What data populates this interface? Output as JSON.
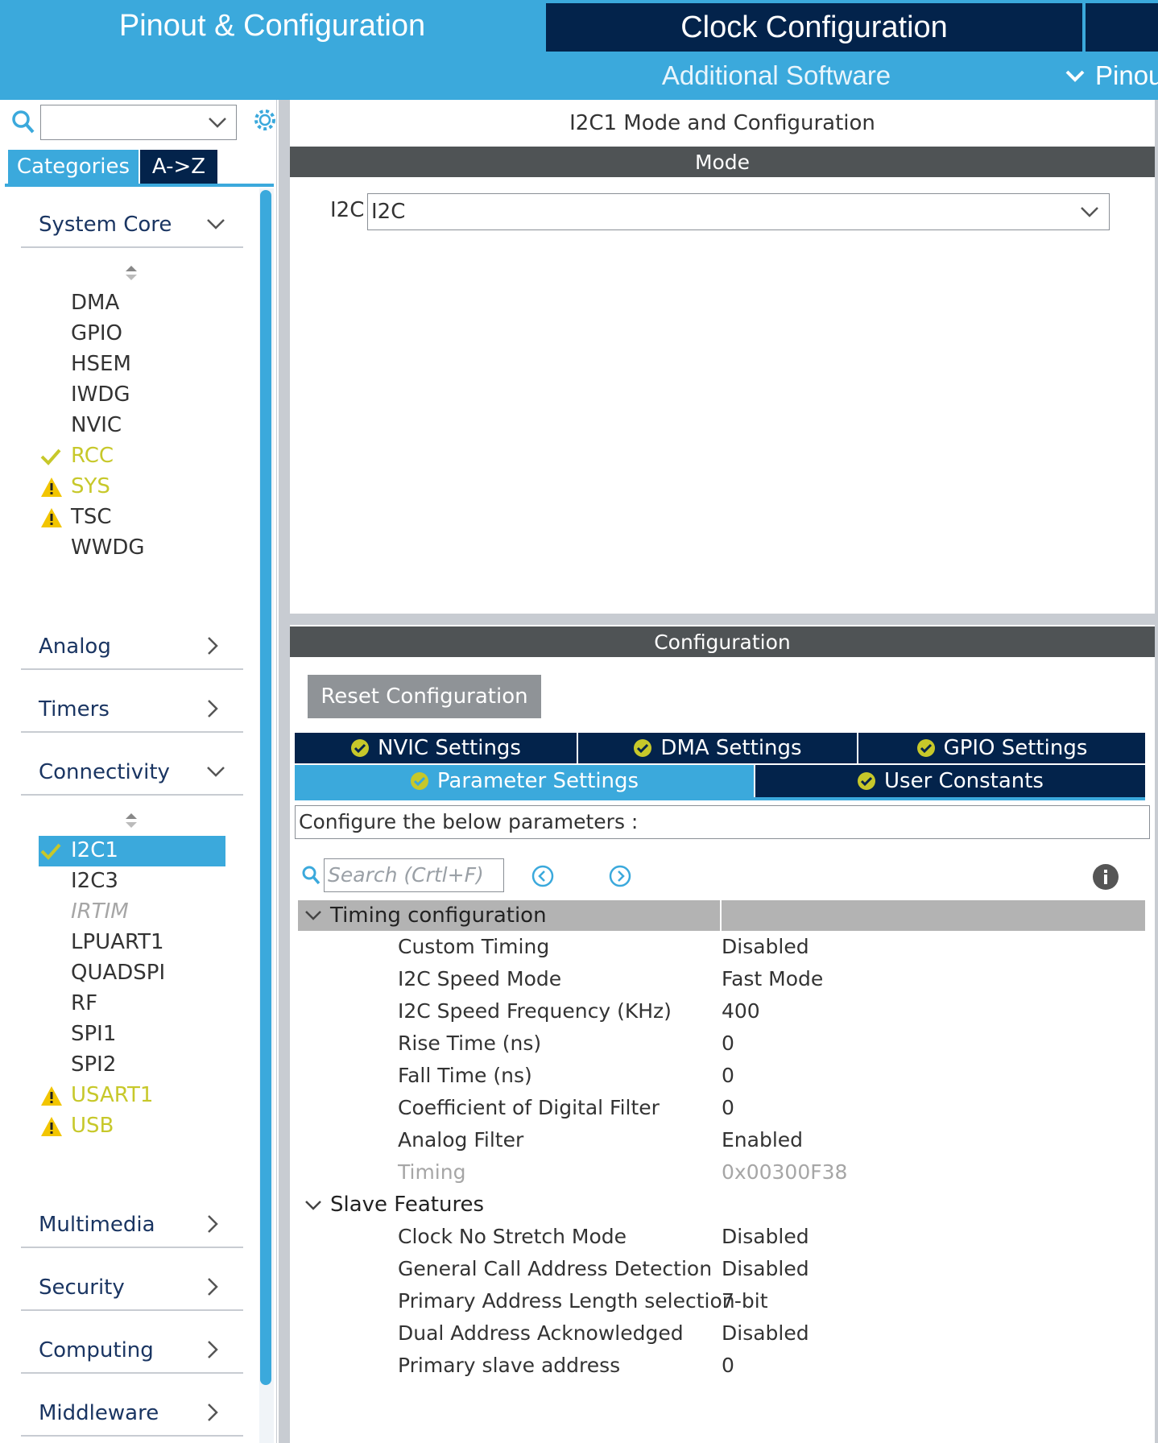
{
  "header": {
    "tabs": [
      {
        "label": "Pinout & Configuration",
        "active": true
      },
      {
        "label": "Clock Configuration",
        "active": false
      }
    ],
    "subnav": {
      "software": "Additional Software",
      "pinout": "Pinout"
    }
  },
  "sidebar": {
    "search_value": "",
    "mode_tabs": [
      "Categories",
      "A->Z"
    ],
    "categories": [
      {
        "label": "System Core",
        "expanded": true
      },
      {
        "label": "Analog",
        "expanded": false
      },
      {
        "label": "Timers",
        "expanded": false
      },
      {
        "label": "Connectivity",
        "expanded": true
      },
      {
        "label": "Multimedia",
        "expanded": false
      },
      {
        "label": "Security",
        "expanded": false
      },
      {
        "label": "Computing",
        "expanded": false
      },
      {
        "label": "Middleware",
        "expanded": false
      }
    ],
    "system_core_items": [
      {
        "label": "DMA",
        "status": "none"
      },
      {
        "label": "GPIO",
        "status": "none"
      },
      {
        "label": "HSEM",
        "status": "none"
      },
      {
        "label": "IWDG",
        "status": "none"
      },
      {
        "label": "NVIC",
        "status": "none"
      },
      {
        "label": "RCC",
        "status": "ok"
      },
      {
        "label": "SYS",
        "status": "warning"
      },
      {
        "label": "TSC",
        "status": "warning"
      },
      {
        "label": "WWDG",
        "status": "none"
      }
    ],
    "connectivity_items": [
      {
        "label": "I2C1",
        "status": "ok",
        "selected": true
      },
      {
        "label": "I2C3",
        "status": "none"
      },
      {
        "label": "IRTIM",
        "status": "disabled"
      },
      {
        "label": "LPUART1",
        "status": "none"
      },
      {
        "label": "QUADSPI",
        "status": "none"
      },
      {
        "label": "RF",
        "status": "none"
      },
      {
        "label": "SPI1",
        "status": "none"
      },
      {
        "label": "SPI2",
        "status": "none"
      },
      {
        "label": "USART1",
        "status": "warning"
      },
      {
        "label": "USB",
        "status": "warning"
      }
    ]
  },
  "mode_panel": {
    "title": "I2C1 Mode and Configuration",
    "bar": "Mode",
    "i2c_label": "I2C",
    "i2c_value": "I2C"
  },
  "config_panel": {
    "bar": "Configuration",
    "reset_label": "Reset Configuration",
    "tabs_row1": [
      "NVIC Settings",
      "DMA Settings",
      "GPIO Settings"
    ],
    "tabs_row2": [
      "Parameter Settings",
      "User Constants"
    ],
    "hint": "Configure the below parameters :",
    "search_placeholder": "Search (Crtl+F)",
    "groups": [
      {
        "label": "Timing configuration",
        "params": [
          {
            "name": "Custom Timing",
            "value": "Disabled"
          },
          {
            "name": "I2C Speed Mode",
            "value": "Fast Mode"
          },
          {
            "name": "I2C Speed Frequency (KHz)",
            "value": "400"
          },
          {
            "name": "Rise Time (ns)",
            "value": "0"
          },
          {
            "name": "Fall Time (ns)",
            "value": "0"
          },
          {
            "name": "Coefficient of Digital Filter",
            "value": "0"
          },
          {
            "name": "Analog Filter",
            "value": "Enabled"
          },
          {
            "name": "Timing",
            "value": "0x00300F38",
            "readonly": true
          }
        ]
      },
      {
        "label": "Slave Features",
        "params": [
          {
            "name": "Clock No Stretch Mode",
            "value": "Disabled"
          },
          {
            "name": "General Call Address Detection",
            "value": "Disabled"
          },
          {
            "name": "Primary Address Length selection",
            "value": "7-bit"
          },
          {
            "name": "Dual Address Acknowledged",
            "value": "Disabled"
          },
          {
            "name": "Primary slave address",
            "value": "0"
          }
        ]
      }
    ]
  },
  "colors": {
    "accent": "#3ba9dc",
    "navy": "#03234b",
    "bar": "#4f5355",
    "warn": "#f2c500",
    "ok_text": "#c7c82a"
  },
  "icons": [
    "search-icon",
    "gear-icon",
    "chevron-down-icon",
    "chevron-right-icon",
    "check-icon",
    "warning-icon",
    "check-circle-icon",
    "info-icon",
    "prev-icon",
    "next-icon"
  ]
}
